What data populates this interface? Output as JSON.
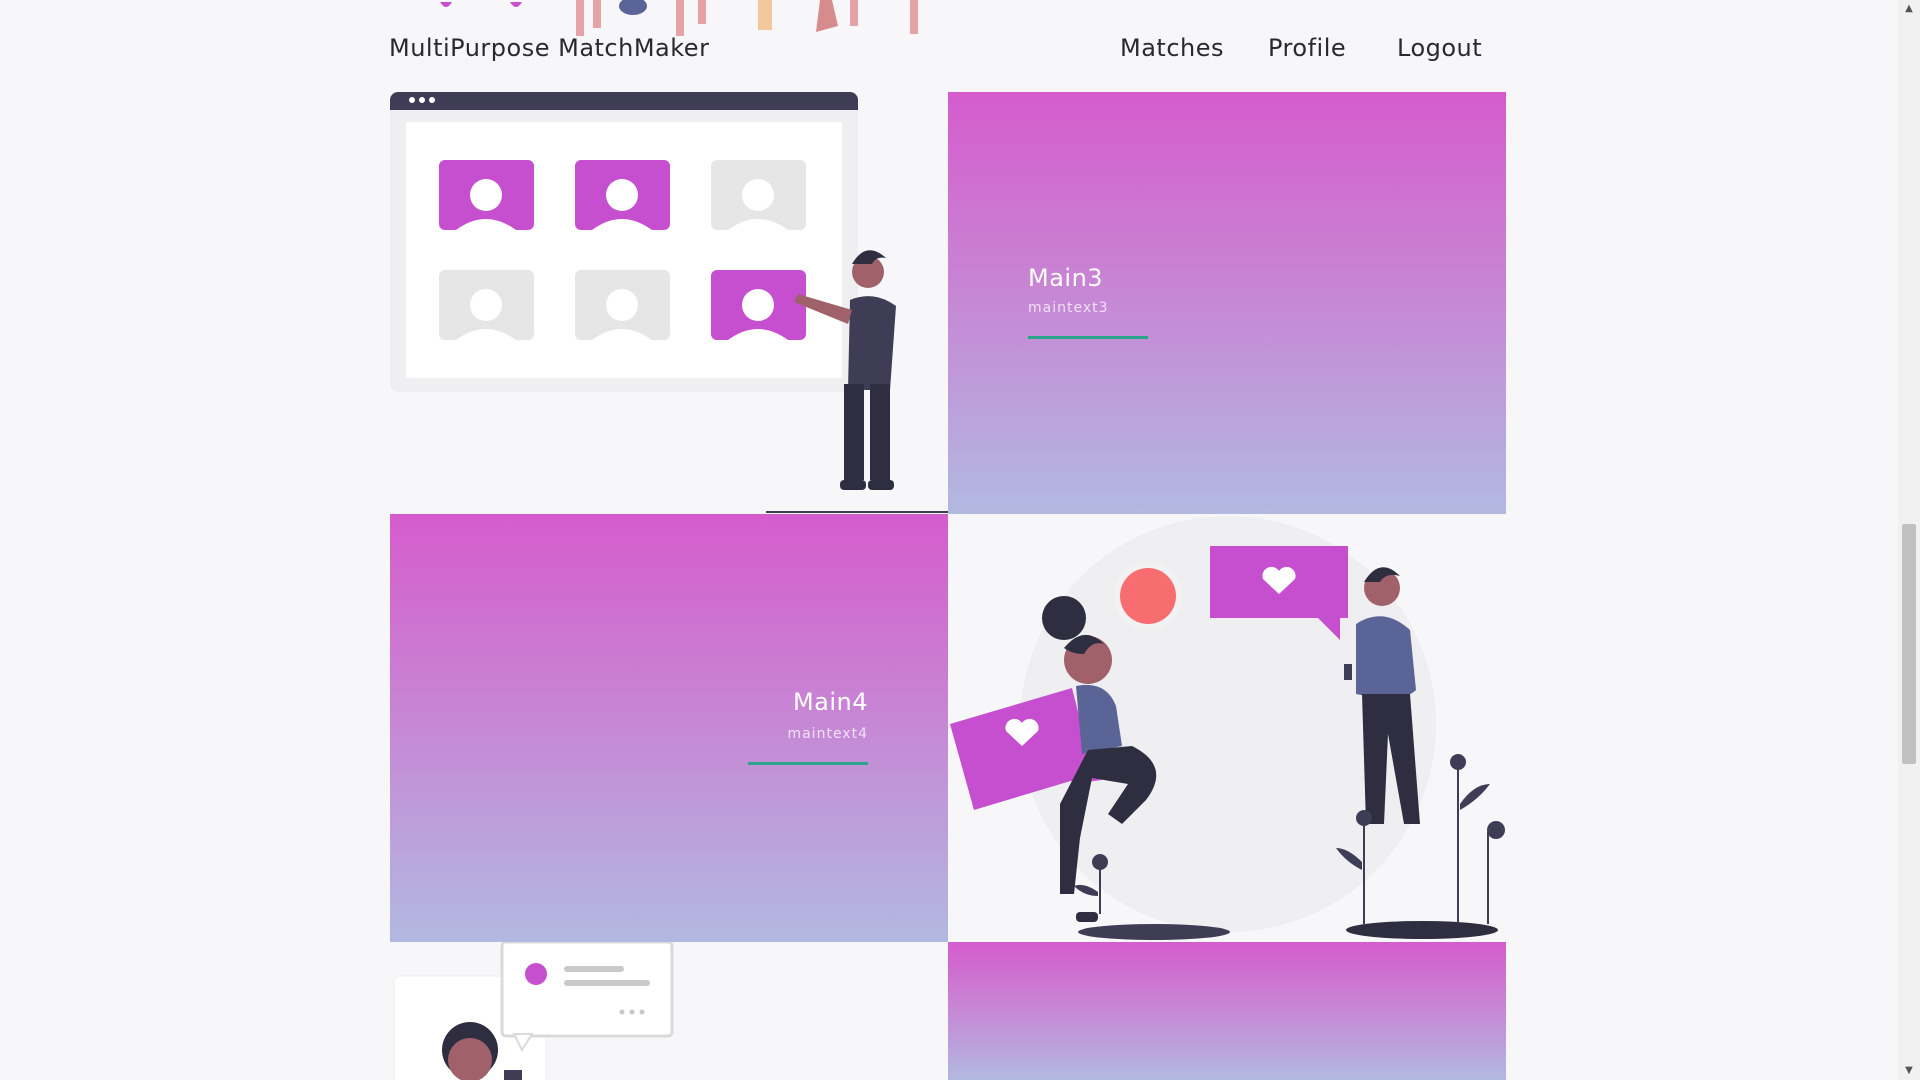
{
  "header": {
    "brand": "MultiPurpose MatchMaker",
    "nav": [
      "Matches",
      "Profile",
      "Logout"
    ]
  },
  "cards": [
    {
      "title": "Main3",
      "subtitle": "maintext3"
    },
    {
      "title": "Main4",
      "subtitle": "maintext4"
    }
  ],
  "colors": {
    "accent": "#d55ccd",
    "gradient_end": "#b2b9e1",
    "underline": "#2aa58b",
    "dark_figure": "#3f3d56",
    "coral": "#f86d70"
  },
  "scrollbar": {
    "up": "▲",
    "down": "▼"
  }
}
